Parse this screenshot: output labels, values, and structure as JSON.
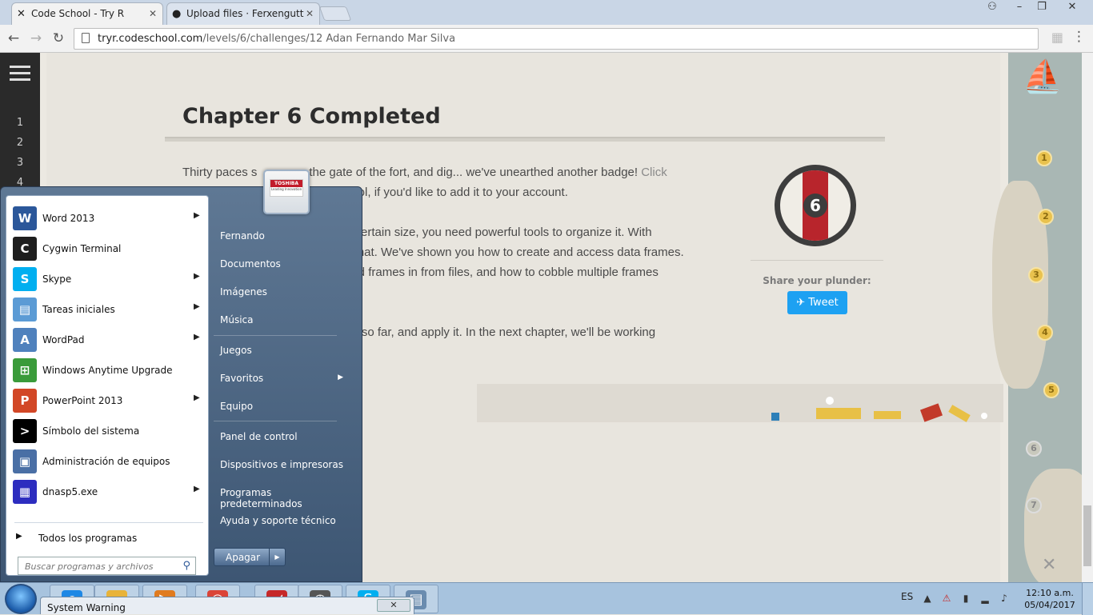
{
  "browser": {
    "tabs": [
      {
        "title": "Code School - Try R",
        "icon": "code-school-icon"
      },
      {
        "title": "Upload files · Ferxengutt",
        "icon": "github-icon"
      }
    ],
    "url_host": "tryr.codeschool.com",
    "url_path": "/levels/6/challenges/12 Adan Fernando Mar Silva"
  },
  "editor": {
    "line_numbers": [
      "1",
      "2",
      "3",
      "4"
    ]
  },
  "lesson": {
    "title": "Chapter 6 Completed",
    "paragraphs": [
      {
        "text": "Thirty paces s",
        "text_after": "om the gate of the fort, and dig... we've unearthed another badge!",
        "link": "Click"
      },
      {
        "text": "hool, if you'd like to add it to your account."
      },
      {
        "text": "a certain size, you need powerful tools to organize it. With"
      },
      {
        "text": "y that. We've shown you how to create and access data frames."
      },
      {
        "text": "oad frames in from files, and how to cobble multiple frames"
      },
      {
        "text": "ed so far, and apply it. In the next chapter, we'll be working"
      }
    ],
    "badge_number": "6",
    "share_label": "Share your plunder:",
    "tweet_label": "Tweet"
  },
  "map": {
    "nodes": [
      "1",
      "2",
      "3",
      "4",
      "5",
      "6",
      "7"
    ]
  },
  "start_menu": {
    "programs": [
      {
        "label": "Word 2013",
        "icon": "word-icon",
        "color": "#2b579a",
        "glyph": "W",
        "submenu": true
      },
      {
        "label": "Cygwin Terminal",
        "icon": "terminal-icon",
        "color": "#1e1e1e",
        "glyph": "C",
        "submenu": false
      },
      {
        "label": "Skype",
        "icon": "skype-icon",
        "color": "#00aff0",
        "glyph": "S",
        "submenu": true
      },
      {
        "label": "Tareas iniciales",
        "icon": "tasks-icon",
        "color": "#5b9bd5",
        "glyph": "▤",
        "submenu": true
      },
      {
        "label": "WordPad",
        "icon": "wordpad-icon",
        "color": "#4f81bd",
        "glyph": "A",
        "submenu": true
      },
      {
        "label": "Windows Anytime Upgrade",
        "icon": "windows-flag-icon",
        "color": "#3a9b3a",
        "glyph": "⊞",
        "submenu": false
      },
      {
        "label": "PowerPoint 2013",
        "icon": "powerpoint-icon",
        "color": "#d24726",
        "glyph": "P",
        "submenu": true
      },
      {
        "label": "Símbolo del sistema",
        "icon": "cmd-icon",
        "color": "#000000",
        "glyph": ">",
        "submenu": false
      },
      {
        "label": "Administración de equipos",
        "icon": "computer-management-icon",
        "color": "#4a6fa5",
        "glyph": "▣",
        "submenu": false
      },
      {
        "label": "dnasp5.exe",
        "icon": "dnasp-icon",
        "color": "#2d2dbf",
        "glyph": "▦",
        "submenu": true
      }
    ],
    "all_programs": "Todos los programas",
    "search_placeholder": "Buscar programas y archivos",
    "right_items": [
      {
        "label": "Fernando",
        "submenu": false
      },
      {
        "label": "Documentos",
        "submenu": false
      },
      {
        "label": "Imágenes",
        "submenu": false
      },
      {
        "label": "Música",
        "submenu": false
      },
      {
        "label": "Juegos",
        "submenu": false
      },
      {
        "label": "Favoritos",
        "submenu": true
      },
      {
        "label": "Equipo",
        "submenu": false
      },
      {
        "label": "Panel de control",
        "submenu": false
      },
      {
        "label": "Dispositivos e impresoras",
        "submenu": false
      },
      {
        "label": "Programas predeterminados",
        "submenu": false
      },
      {
        "label": "Ayuda y soporte técnico",
        "submenu": false
      }
    ],
    "shutdown_label": "Apagar",
    "user_logo_text": "TOSHIBA",
    "user_logo_tagline": "Leading Innovation"
  },
  "taskbar": {
    "language": "ES",
    "time": "12:10 a.m.",
    "date": "05/04/2017",
    "system_warning_title": "System Warning",
    "apps": [
      {
        "icon": "internet-explorer-icon",
        "color": "#1e88e5",
        "glyph": "e"
      },
      {
        "icon": "file-explorer-icon",
        "color": "#e8b339",
        "glyph": "▬"
      },
      {
        "icon": "media-player-icon",
        "color": "#e07b1f",
        "glyph": "▶"
      },
      {
        "icon": "chrome-icon",
        "color": "#db4437",
        "glyph": "◉"
      },
      {
        "icon": "app-red-icon",
        "color": "#c62828",
        "glyph": "◢"
      },
      {
        "icon": "clock-app-icon",
        "color": "#555555",
        "glyph": "◷"
      },
      {
        "icon": "skype-taskbar-icon",
        "color": "#00aff0",
        "glyph": "S"
      },
      {
        "icon": "notepad-icon",
        "color": "#6a8caf",
        "glyph": "▤"
      }
    ]
  }
}
